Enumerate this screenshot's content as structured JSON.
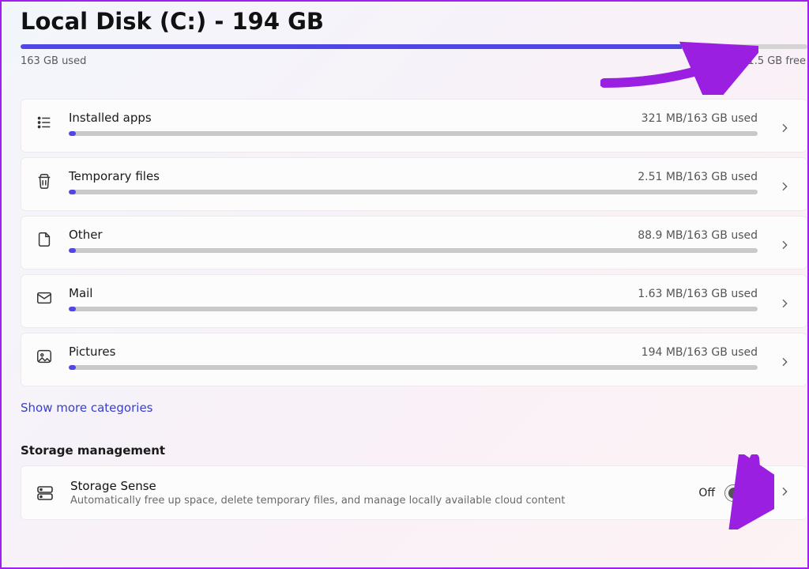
{
  "header": {
    "title": "Local Disk (C:) - 194 GB",
    "used_label": "163 GB used",
    "free_label": "31.5 GB free",
    "used_pct": 84
  },
  "categories": [
    {
      "icon": "apps",
      "name": "Installed apps",
      "usage": "321 MB/163 GB used",
      "pct": 1
    },
    {
      "icon": "trash",
      "name": "Temporary files",
      "usage": "2.51 MB/163 GB used",
      "pct": 1
    },
    {
      "icon": "doc",
      "name": "Other",
      "usage": "88.9 MB/163 GB used",
      "pct": 1
    },
    {
      "icon": "mail",
      "name": "Mail",
      "usage": "1.63 MB/163 GB used",
      "pct": 1
    },
    {
      "icon": "picture",
      "name": "Pictures",
      "usage": "194 MB/163 GB used",
      "pct": 1
    }
  ],
  "show_more": "Show more categories",
  "section_heading": "Storage management",
  "storage_sense": {
    "title": "Storage Sense",
    "desc": "Automatically free up space, delete temporary files, and manage locally available cloud content",
    "state_label": "Off"
  }
}
